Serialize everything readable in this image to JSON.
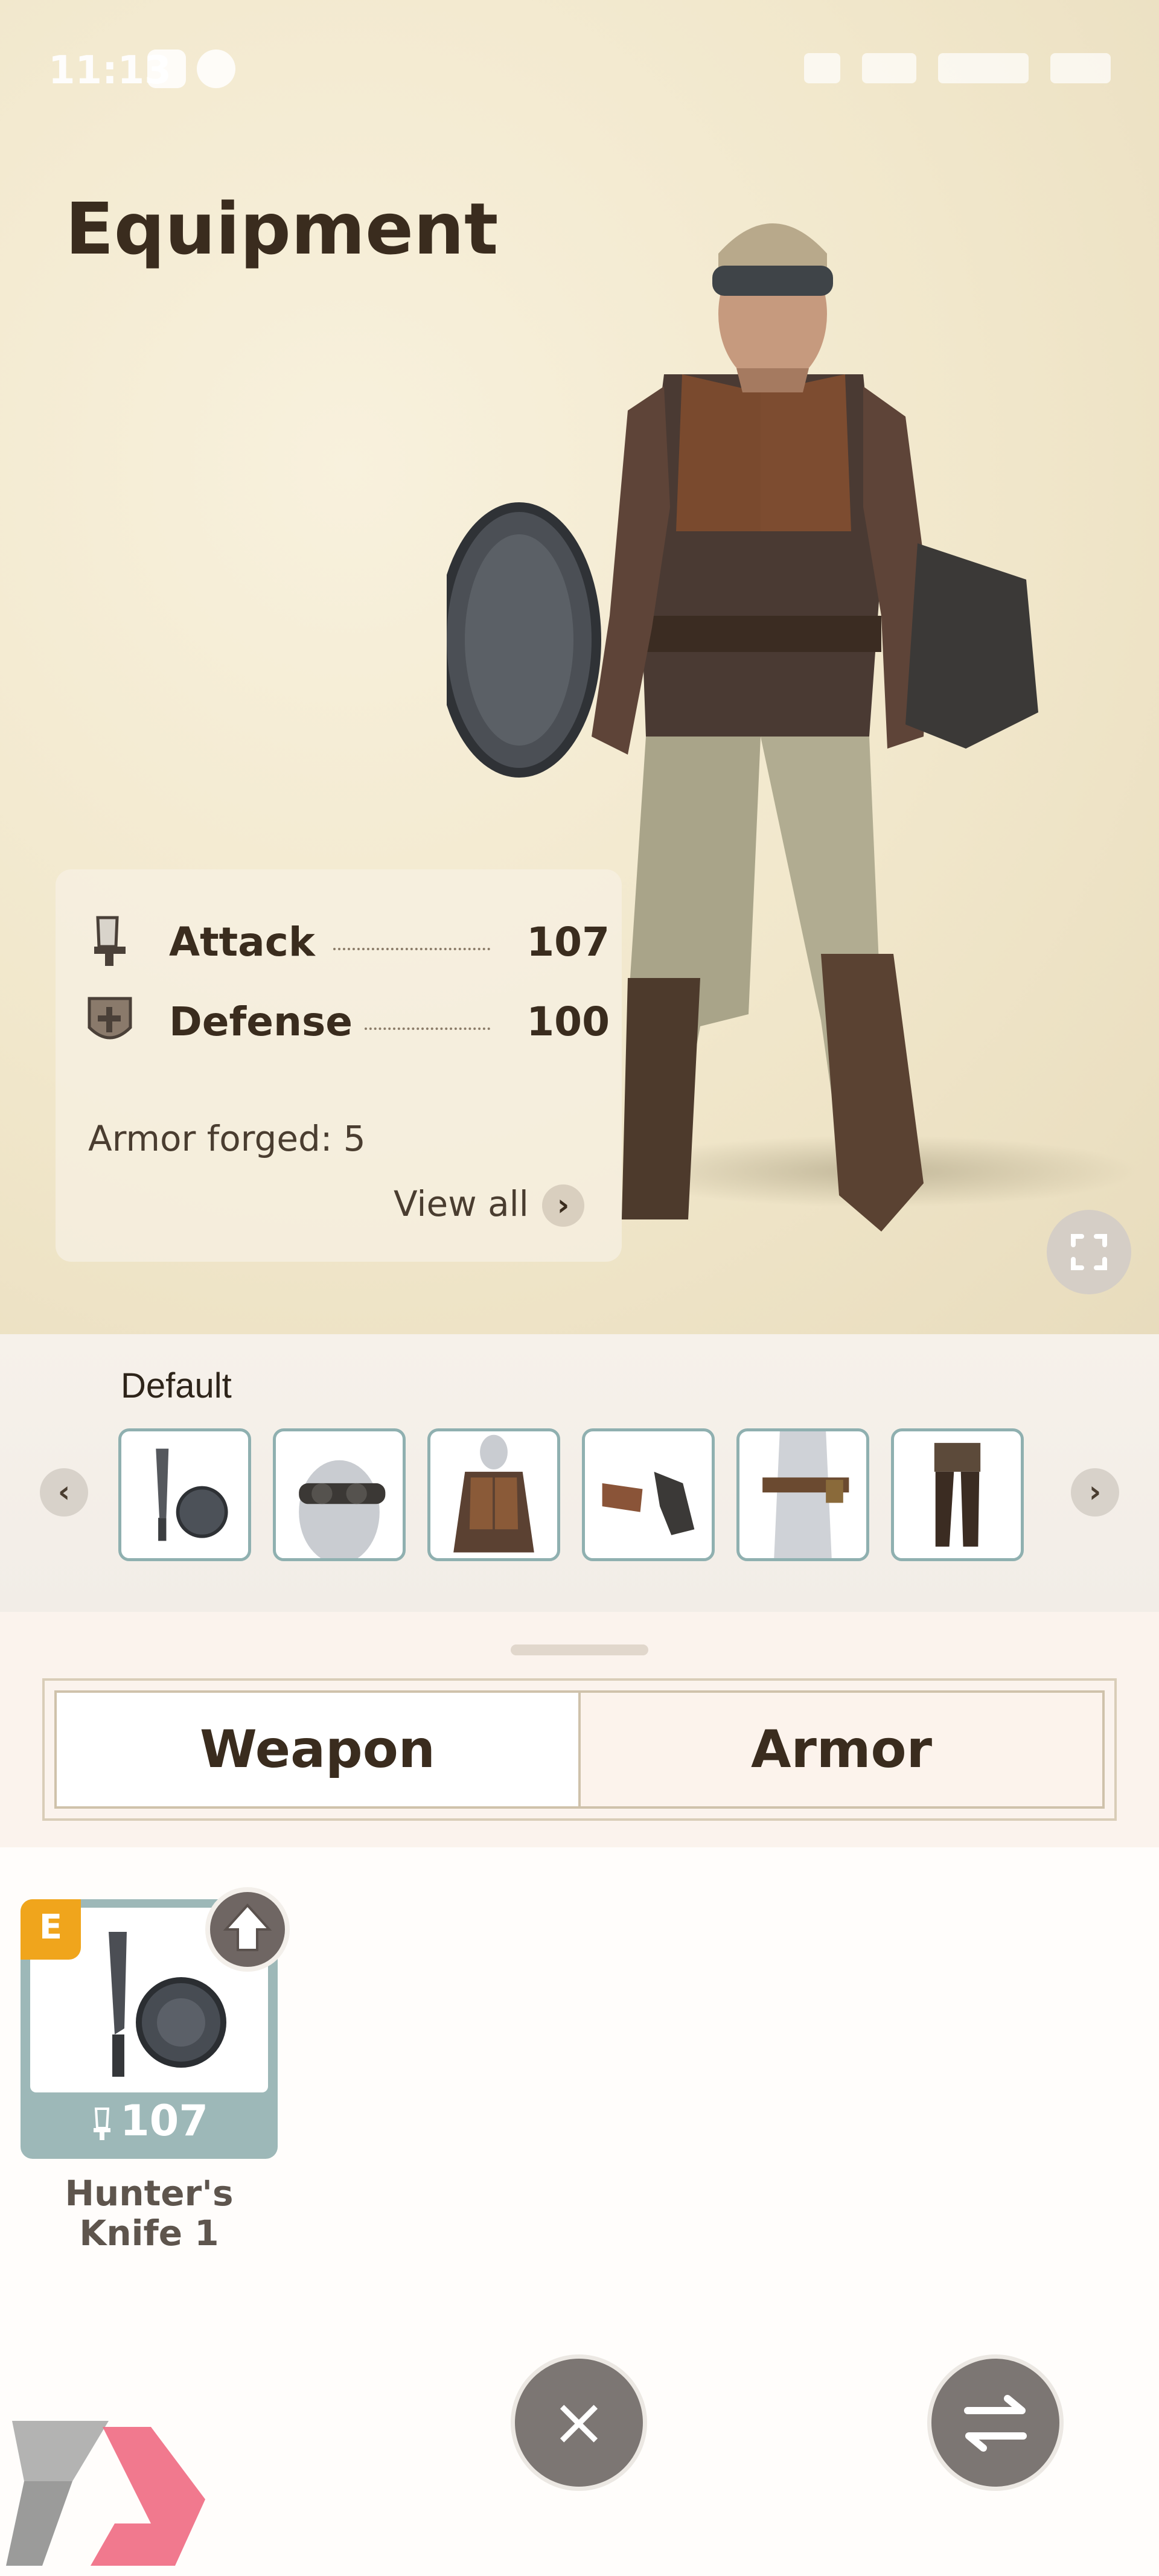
{
  "status_bar": {
    "time": "11:13"
  },
  "header": {
    "title": "Equipment"
  },
  "stats": {
    "attack": {
      "label": "Attack",
      "value": "107"
    },
    "defense": {
      "label": "Defense",
      "value": "100"
    },
    "armor_forged": "Armor forged: 5",
    "view_all": "View all"
  },
  "loadout": {
    "label": "Default",
    "slots": [
      {
        "name": "weapon",
        "icon": "knife-shield-icon"
      },
      {
        "name": "head",
        "icon": "goggles-icon"
      },
      {
        "name": "chest",
        "icon": "jacket-icon"
      },
      {
        "name": "arms",
        "icon": "gauntlets-icon"
      },
      {
        "name": "waist",
        "icon": "belt-icon"
      },
      {
        "name": "legs",
        "icon": "boots-icon"
      }
    ]
  },
  "tabs": {
    "weapon": "Weapon",
    "armor": "Armor"
  },
  "items": [
    {
      "badge": "E",
      "attack": "107",
      "name_line1": "Hunter's",
      "name_line2": "Knife 1"
    }
  ],
  "buttons": {
    "close_symbol": "×"
  },
  "colors": {
    "badge": "#f0a51c",
    "card": "#9db8b8",
    "button": "#7c7673"
  }
}
